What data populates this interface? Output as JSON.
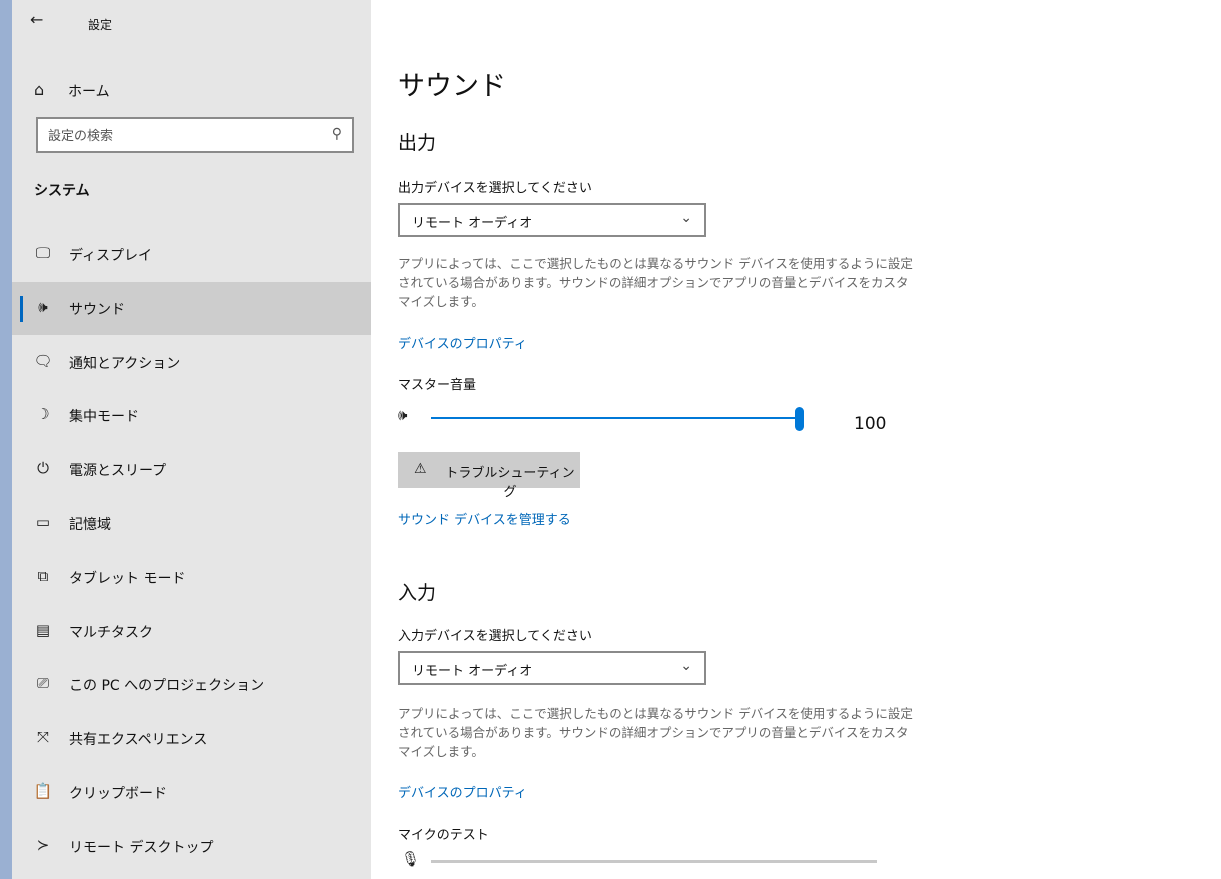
{
  "window": {
    "title": "設定"
  },
  "sidebar": {
    "home_label": "ホーム",
    "search_placeholder": "設定の検索",
    "section": "システム",
    "items": [
      {
        "label": "ディスプレイ",
        "icon": "monitor-icon",
        "glyph": "🖵"
      },
      {
        "label": "サウンド",
        "icon": "speaker-icon",
        "glyph": "🕪",
        "active": true
      },
      {
        "label": "通知とアクション",
        "icon": "notification-icon",
        "glyph": "🗨"
      },
      {
        "label": "集中モード",
        "icon": "moon-icon",
        "glyph": "☽"
      },
      {
        "label": "電源とスリープ",
        "icon": "power-icon",
        "glyph": "⏻"
      },
      {
        "label": "記憶域",
        "icon": "storage-icon",
        "glyph": "▭"
      },
      {
        "label": "タブレット モード",
        "icon": "tablet-icon",
        "glyph": "⧉"
      },
      {
        "label": "マルチタスク",
        "icon": "multitask-icon",
        "glyph": "▤"
      },
      {
        "label": "この PC へのプロジェクション",
        "icon": "projection-icon",
        "glyph": "⎚"
      },
      {
        "label": "共有エクスペリエンス",
        "icon": "shared-experience-icon",
        "glyph": "⤧"
      },
      {
        "label": "クリップボード",
        "icon": "clipboard-icon",
        "glyph": "📋"
      },
      {
        "label": "リモート デスクトップ",
        "icon": "remote-desktop-icon",
        "glyph": "≻"
      }
    ]
  },
  "main": {
    "title": "サウンド",
    "output": {
      "heading": "出力",
      "device_label": "出力デバイスを選択してください",
      "device_value": "リモート オーディオ",
      "description": "アプリによっては、ここで選択したものとは異なるサウンド デバイスを使用するように設定されている場合があります。サウンドの詳細オプションでアプリの音量とデバイスをカスタマイズします。",
      "properties_link": "デバイスのプロパティ",
      "volume_label": "マスター音量",
      "volume_value": "100",
      "volume_level": 100,
      "troubleshoot_label": "トラブルシューティング",
      "manage_link": "サウンド デバイスを管理する"
    },
    "input": {
      "heading": "入力",
      "device_label": "入力デバイスを選択してください",
      "device_value": "リモート オーディオ",
      "description": "アプリによっては、ここで選択したものとは異なるサウンド デバイスを使用するように設定されている場合があります。サウンドの詳細オプションでアプリの音量とデバイスをカスタマイズします。",
      "properties_link": "デバイスのプロパティ",
      "mic_test_label": "マイクのテスト",
      "mic_level": 0
    }
  },
  "colors": {
    "accent": "#0078d7",
    "link": "#0067b8",
    "sidebar_bg": "#e6e6e6",
    "active_item_bg": "#cdcdcd"
  }
}
